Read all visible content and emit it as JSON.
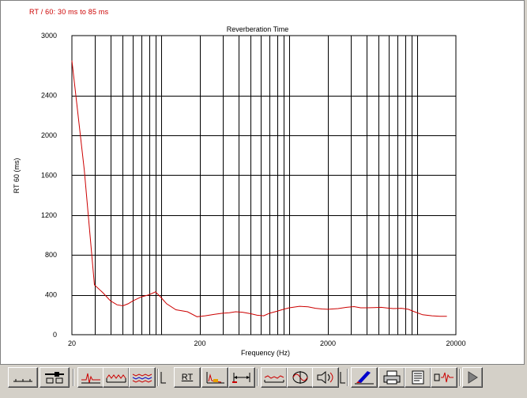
{
  "status_text": "RT / 60: 30 ms to 85 ms",
  "colors": {
    "curve": "#cc0000",
    "grid": "#000000",
    "status": "#cc0000"
  },
  "chart_data": {
    "type": "line",
    "title": "Reverberation Time",
    "xlabel": "Frequency (Hz)",
    "ylabel": "RT 60 (ms)",
    "x_scale": "log",
    "xlim": [
      20,
      20000
    ],
    "ylim": [
      0,
      3000
    ],
    "x_ticks": [
      20,
      200,
      2000,
      20000
    ],
    "y_ticks": [
      0,
      400,
      800,
      1200,
      1600,
      2000,
      2400,
      3000
    ],
    "grid": true,
    "series": [
      {
        "x": [
          20,
          25,
          30,
          35,
          40,
          45,
          50,
          55,
          60,
          70,
          80,
          90,
          100,
          110,
          130,
          160,
          190,
          220,
          260,
          300,
          340,
          380,
          430,
          500,
          560,
          630,
          700,
          800,
          900,
          1000,
          1200,
          1400,
          1600,
          1800,
          2000,
          2400,
          2800,
          3200,
          3600,
          4000,
          4600,
          5200,
          5800,
          6500,
          7500,
          8500,
          9500,
          11000,
          13000,
          15000,
          17000
        ],
        "y": [
          2750,
          1650,
          500,
          420,
          340,
          300,
          290,
          310,
          340,
          380,
          400,
          430,
          370,
          310,
          250,
          230,
          180,
          190,
          205,
          215,
          220,
          230,
          225,
          210,
          195,
          190,
          215,
          235,
          255,
          270,
          285,
          280,
          265,
          258,
          255,
          262,
          275,
          282,
          270,
          270,
          272,
          275,
          268,
          262,
          265,
          255,
          230,
          200,
          190,
          185,
          185
        ]
      }
    ]
  },
  "toolbar": {
    "rt_label": "RT",
    "buttons": [
      "axis-scale",
      "slider-settings",
      "impulse-response",
      "waterfall",
      "cumulative-spectrum",
      "rt",
      "energy-time",
      "time-window",
      "frequency-response",
      "phase",
      "speaker-test",
      "color-edit",
      "print",
      "report",
      "signal-generator",
      "play"
    ]
  }
}
